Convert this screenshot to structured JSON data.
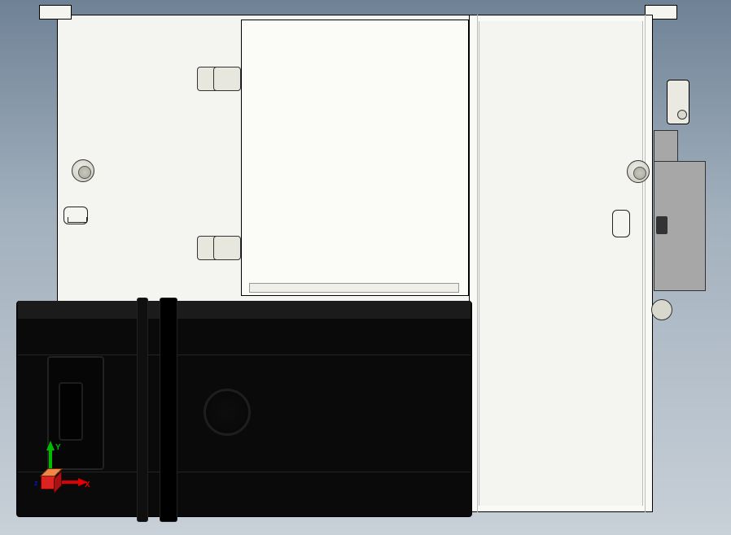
{
  "triad": {
    "x_label": "X",
    "y_label": "Y",
    "z_label": "z"
  },
  "colors": {
    "axis_x": "#d00",
    "axis_y": "#0b0",
    "axis_z": "#11b",
    "body": "#f4f4f0",
    "motor": "#0a0a0a",
    "bracket": "#a7a7a7"
  }
}
